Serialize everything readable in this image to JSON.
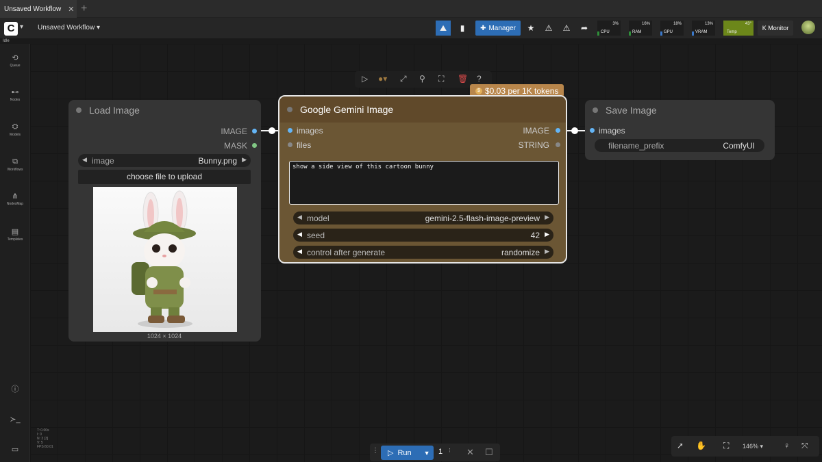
{
  "tab": {
    "title": "Unsaved Workflow",
    "close": "✕",
    "new": "+"
  },
  "menubar": {
    "workflow_name": "Unsaved Workflow",
    "manager_label": "Manager",
    "monitor_label": "Monitor"
  },
  "monitor": [
    {
      "name": "CPU",
      "pct": "3%",
      "color": "#2f8f3a",
      "fill": 0.03
    },
    {
      "name": "RAM",
      "pct": "16%",
      "color": "#2f8f3a",
      "fill": 0.16
    },
    {
      "name": "GPU",
      "pct": "18%",
      "color": "#3a78c9",
      "fill": 0.18
    },
    {
      "name": "VRAM",
      "pct": "13%",
      "color": "#3a78c9",
      "fill": 0.13
    },
    {
      "name": "Temp",
      "pct": "43°",
      "color": "#7a9a1a",
      "fill": 1.0
    }
  ],
  "status": {
    "idle": "Idle"
  },
  "sidebar": [
    {
      "label": "Queue",
      "icon": "history-icon"
    },
    {
      "label": "Nodes",
      "icon": "nodes-icon"
    },
    {
      "label": "Models",
      "icon": "models-icon"
    },
    {
      "label": "Workflows",
      "icon": "workflows-icon"
    },
    {
      "label": "NodesMap",
      "icon": "nodesmap-icon"
    },
    {
      "label": "Templates",
      "icon": "templates-icon"
    }
  ],
  "load_node": {
    "title": "Load Image",
    "out_image": "IMAGE",
    "out_mask": "MASK",
    "image_label": "image",
    "image_value": "Bunny.png",
    "upload_label": "choose file to upload",
    "dims": "1024 × 1024"
  },
  "gemini_node": {
    "title": "Google Gemini Image",
    "cost": "$0.03 per 1K tokens",
    "in_images": "images",
    "in_files": "files",
    "out_image": "IMAGE",
    "out_string": "STRING",
    "prompt": "show a side view of this cartoon bunny",
    "model_label": "model",
    "model_value": "gemini-2.5-flash-image-preview",
    "seed_label": "seed",
    "seed_value": "42",
    "control_label": "control after generate",
    "control_value": "randomize"
  },
  "save_node": {
    "title": "Save Image",
    "in_images": "images",
    "prefix_label": "filename_prefix",
    "prefix_value": "ComfyUI"
  },
  "stats": [
    "T: 0.00s",
    "I: 0",
    "N: 3 [3]",
    "V: 5",
    "FPS:60.01"
  ],
  "runbar": {
    "run_label": "Run",
    "count": "1"
  },
  "canvas_controls": {
    "zoom": "146%"
  }
}
